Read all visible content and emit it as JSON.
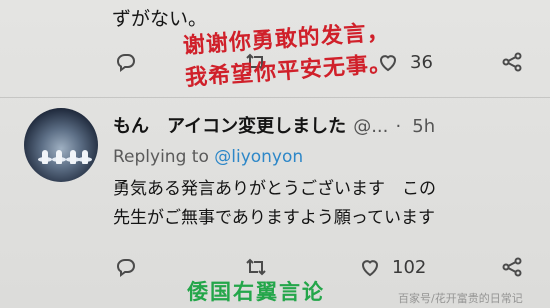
{
  "prev_tweet": {
    "text_fragment": "ずがない。",
    "retweet_count": "",
    "like_count": "36"
  },
  "tweet": {
    "display_name": "もん　アイコン変更しました",
    "handle": "@...",
    "time": "5h",
    "replying_prefix": "Replying to",
    "replying_to": "@liyonyon",
    "body_line1": "勇気ある発言ありがとうございます　この",
    "body_line2": "先生がご無事でありますよう願っています",
    "retweet_count": "",
    "like_count": "102"
  },
  "overlays": {
    "red_line1": "谢谢你勇敢的发言，",
    "red_line2": "我希望你平安无事。",
    "green_caption": "倭国右翼言论",
    "watermark": "百家号/花开富贵的日常记"
  },
  "icons": [
    "reply-icon",
    "retweet-icon",
    "like-icon",
    "share-icon"
  ],
  "colors": {
    "link": "#2d87c8",
    "red_overlay": "#d0202a",
    "green_overlay": "#24a64a"
  }
}
